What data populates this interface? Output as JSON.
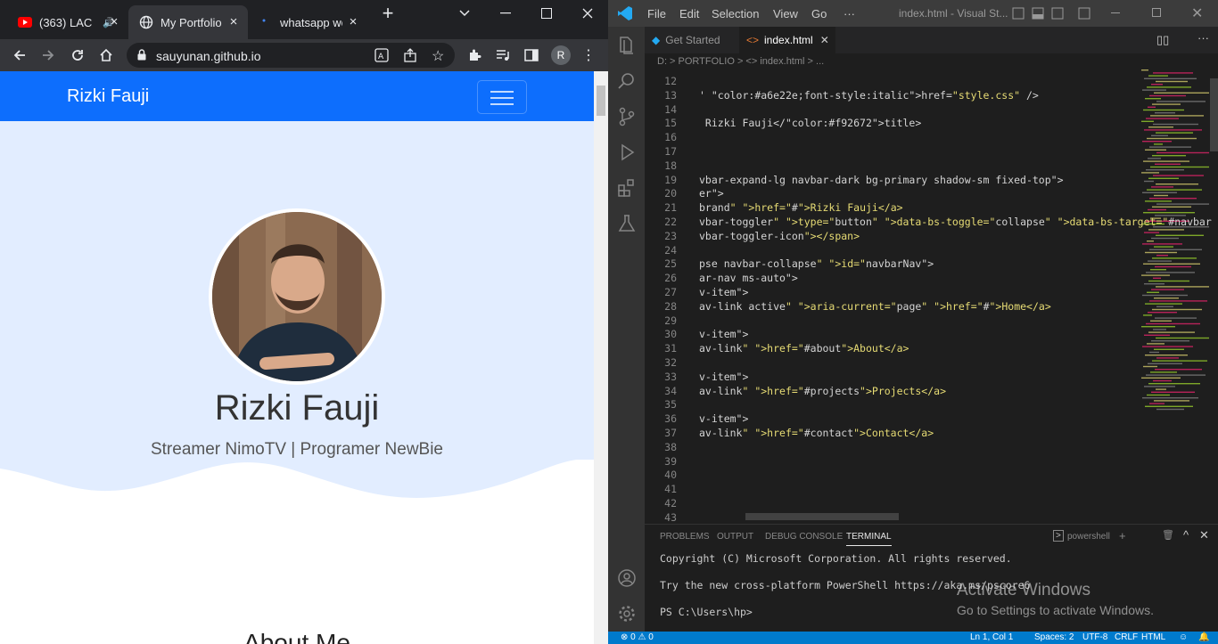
{
  "chrome": {
    "tabs": [
      {
        "title": "(363) LAC",
        "icon": "youtube-icon"
      },
      {
        "title": "My Portfolio",
        "icon": "globe-icon"
      },
      {
        "title": "whatsapp we",
        "icon": "search-icon"
      }
    ],
    "url": "sauyunan.github.io",
    "profile_initial": "R"
  },
  "webpage": {
    "brand": "Rizki Fauji",
    "hero_name": "Rizki Fauji",
    "tagline": "Streamer NimoTV | Programer NewBie",
    "section_heading": "About Me",
    "colors": {
      "navbar": "#0d6efd",
      "hero": "#e2edff"
    }
  },
  "vscode": {
    "menu": [
      "File",
      "Edit",
      "Selection",
      "View",
      "Go",
      "···"
    ],
    "window_title": "index.html - Visual St...",
    "tabs": [
      {
        "label": "Get Started",
        "active": false
      },
      {
        "label": "index.html",
        "active": true
      }
    ],
    "breadcrumb": "D: > PORTFOLIO > <> index.html > ...",
    "code_lines": [
      {
        "n": "12",
        "t": ""
      },
      {
        "n": "13",
        "t": "' href=\"style.css\" />"
      },
      {
        "n": "14",
        "t": ""
      },
      {
        "n": "15",
        "t": " Rizki Fauji</title>"
      },
      {
        "n": "16",
        "t": ""
      },
      {
        "n": "17",
        "t": ""
      },
      {
        "n": "18",
        "t": ""
      },
      {
        "n": "19",
        "t": "vbar-expand-lg navbar-dark bg-primary shadow-sm fixed-top\">"
      },
      {
        "n": "20",
        "t": "er\">"
      },
      {
        "n": "21",
        "t": "brand\" href=\"#\">Rizki Fauji</a>"
      },
      {
        "n": "22",
        "t": "vbar-toggler\" type=\"button\" data-bs-toggle=\"collapse\" data-bs-target=\"#navbar"
      },
      {
        "n": "23",
        "t": "vbar-toggler-icon\"></span>"
      },
      {
        "n": "24",
        "t": ""
      },
      {
        "n": "25",
        "t": "pse navbar-collapse\" id=\"navbarNav\">"
      },
      {
        "n": "26",
        "t": "ar-nav ms-auto\">"
      },
      {
        "n": "27",
        "t": "v-item\">"
      },
      {
        "n": "28",
        "t": "av-link active\" aria-current=\"page\" href=\"#\">Home</a>"
      },
      {
        "n": "29",
        "t": ""
      },
      {
        "n": "30",
        "t": "v-item\">"
      },
      {
        "n": "31",
        "t": "av-link\" href=\"#about\">About</a>"
      },
      {
        "n": "32",
        "t": ""
      },
      {
        "n": "33",
        "t": "v-item\">"
      },
      {
        "n": "34",
        "t": "av-link\" href=\"#projects\">Projects</a>"
      },
      {
        "n": "35",
        "t": ""
      },
      {
        "n": "36",
        "t": "v-item\">"
      },
      {
        "n": "37",
        "t": "av-link\" href=\"#contact\">Contact</a>"
      },
      {
        "n": "38",
        "t": ""
      },
      {
        "n": "39",
        "t": ""
      },
      {
        "n": "40",
        "t": ""
      },
      {
        "n": "41",
        "t": ""
      },
      {
        "n": "42",
        "t": ""
      },
      {
        "n": "43",
        "t": ""
      }
    ],
    "panel_tabs": [
      "PROBLEMS",
      "OUTPUT",
      "DEBUG CONSOLE",
      "TERMINAL"
    ],
    "terminal_shell": "powershell",
    "terminal_lines": [
      "Copyright (C) Microsoft Corporation. All rights reserved.",
      "",
      "Try the new cross-platform PowerShell https://aka.ms/pscore6",
      "",
      "PS C:\\Users\\hp>"
    ],
    "status": {
      "errors": "0",
      "warnings": "0",
      "position": "Ln 1, Col 1",
      "spaces": "Spaces: 2",
      "encoding": "UTF-8",
      "eol": "CRLF",
      "language": "HTML"
    }
  },
  "watermark": {
    "line1": "Activate Windows",
    "line2": "Go to Settings to activate Windows."
  }
}
